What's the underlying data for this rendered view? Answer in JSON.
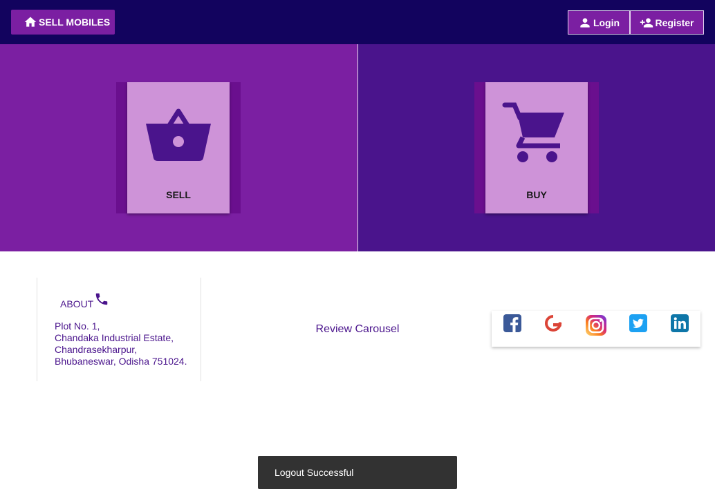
{
  "header": {
    "brand_label": "SELL MOBILES",
    "login_label": "Login",
    "register_label": "Register"
  },
  "panels": {
    "sell_label": "SELL",
    "buy_label": "BUY"
  },
  "about": {
    "title": "ABOUT",
    "address_lines": [
      "Plot No. 1,",
      "Chandaka Industrial Estate,",
      "Chandrasekharpur,",
      "Bhubaneswar, Odisha 751024."
    ]
  },
  "review": {
    "label": "Review Carousel"
  },
  "social": {
    "icons": [
      "facebook-icon",
      "google-icon",
      "instagram-icon",
      "twitter-icon",
      "linkedin-icon"
    ]
  },
  "snackbar": {
    "message": "Logout Successful"
  },
  "colors": {
    "header_bg": "#12035e",
    "primary": "#7b1fa2",
    "dark_purple": "#4a148c",
    "card_bg": "#ce93d8",
    "snackbar_bg": "#323232"
  }
}
